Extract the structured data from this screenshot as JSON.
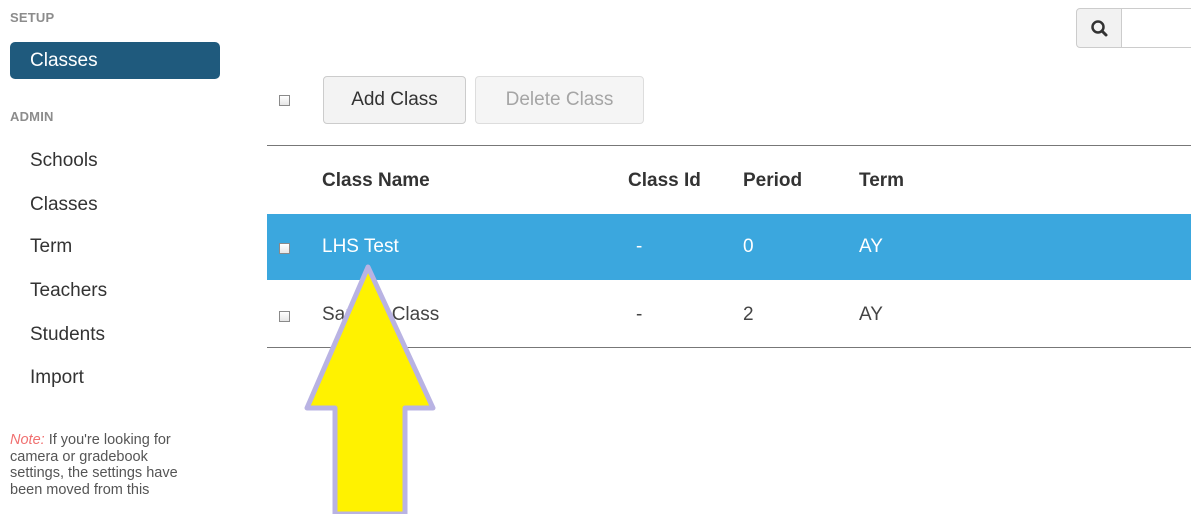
{
  "sidebar": {
    "setup_label": "SETUP",
    "active_item": "Classes",
    "admin_label": "ADMIN",
    "items": [
      "Schools",
      "Classes",
      "Term",
      "Teachers",
      "Students",
      "Import"
    ],
    "note_label": "Note:",
    "note_lines": [
      " If you're looking for",
      "camera or gradebook",
      "settings, the settings have",
      "been moved from this"
    ]
  },
  "search": {
    "icon": "search-icon",
    "placeholder": ""
  },
  "toolbar": {
    "add_label": "Add Class",
    "delete_label": "Delete Class"
  },
  "table": {
    "headers": [
      "Class Name",
      "Class Id",
      "Period",
      "Term"
    ],
    "rows": [
      {
        "name": "LHS Test",
        "id": "-",
        "period": "0",
        "term": "AY",
        "selected": true
      },
      {
        "name": "Sample Class",
        "id": "-",
        "period": "2",
        "term": "AY",
        "selected": false
      }
    ]
  },
  "colors": {
    "accent": "#1f5a7d",
    "selected_row": "#3ba7de",
    "arrow": "#fff200"
  }
}
